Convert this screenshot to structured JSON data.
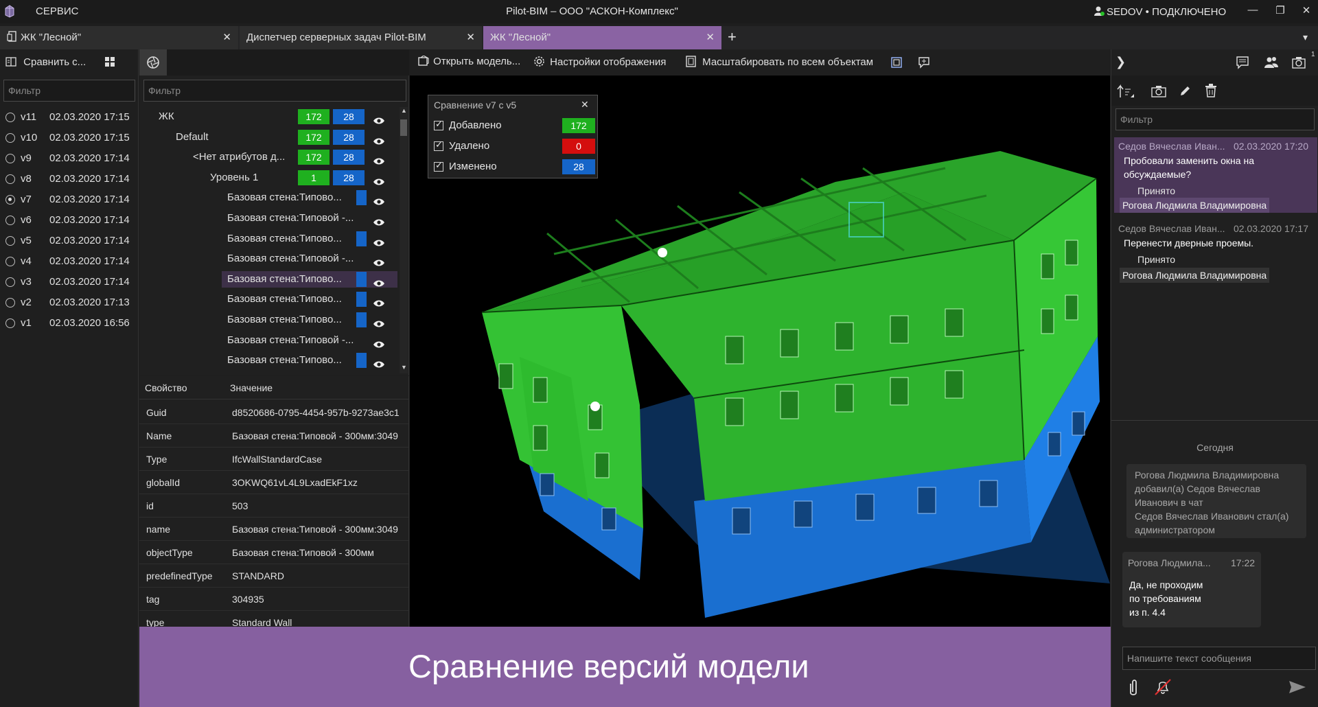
{
  "titlebar": {
    "menu": "СЕРВИС",
    "title": "Pilot-BIM – ООО \"АСКОН-Комплекс\"",
    "user": "SEDOV • ПОДКЛЮЧЕНО",
    "minimize": "—",
    "restore": "❐",
    "close": "✕",
    "dropdown": "▾"
  },
  "tabs": [
    {
      "label": "ЖК \"Лесной\"",
      "close": "✕"
    },
    {
      "label": "Диспетчер серверных задач Pilot-BIM",
      "close": "✕"
    },
    {
      "label": "ЖК \"Лесной\"",
      "close": "✕"
    }
  ],
  "tab_add": "+",
  "left": {
    "compare_label": "Сравнить с...",
    "filter_placeholder": "Фильтр",
    "versions": [
      {
        "name": "v11",
        "date": "02.03.2020 17:15",
        "selected": false
      },
      {
        "name": "v10",
        "date": "02.03.2020 17:15",
        "selected": false
      },
      {
        "name": "v9",
        "date": "02.03.2020 17:14",
        "selected": false
      },
      {
        "name": "v8",
        "date": "02.03.2020 17:14",
        "selected": false
      },
      {
        "name": "v7",
        "date": "02.03.2020 17:14",
        "selected": true
      },
      {
        "name": "v6",
        "date": "02.03.2020 17:14",
        "selected": false
      },
      {
        "name": "v5",
        "date": "02.03.2020 17:14",
        "selected": false
      },
      {
        "name": "v4",
        "date": "02.03.2020 17:14",
        "selected": false
      },
      {
        "name": "v3",
        "date": "02.03.2020 17:14",
        "selected": false
      },
      {
        "name": "v2",
        "date": "02.03.2020 17:13",
        "selected": false
      },
      {
        "name": "v1",
        "date": "02.03.2020 16:56",
        "selected": false
      }
    ]
  },
  "tree": {
    "filter_placeholder": "Фильтр",
    "rows": [
      {
        "label": "ЖК",
        "indent": 0,
        "added": "172",
        "changed": "28"
      },
      {
        "label": "Default",
        "indent": 1,
        "added": "172",
        "changed": "28"
      },
      {
        "label": "<Нет атрибутов д...",
        "indent": 2,
        "added": "172",
        "changed": "28"
      },
      {
        "label": "Уровень 1",
        "indent": 3,
        "added": "1",
        "changed": "28"
      },
      {
        "label": "Базовая стена:Типово...",
        "indent": 4,
        "added": "",
        "changed": "■"
      },
      {
        "label": "Базовая стена:Типовой -...",
        "indent": 4,
        "added": "",
        "changed": ""
      },
      {
        "label": "Базовая стена:Типово...",
        "indent": 4,
        "added": "",
        "changed": "■"
      },
      {
        "label": "Базовая стена:Типовой -...",
        "indent": 4,
        "added": "",
        "changed": ""
      },
      {
        "label": "Базовая стена:Типово...",
        "indent": 4,
        "added": "",
        "changed": "■",
        "highlight": true
      },
      {
        "label": "Базовая стена:Типово...",
        "indent": 4,
        "added": "",
        "changed": "■"
      },
      {
        "label": "Базовая стена:Типово...",
        "indent": 4,
        "added": "",
        "changed": "■"
      },
      {
        "label": "Базовая стена:Типовой -...",
        "indent": 4,
        "added": "",
        "changed": ""
      },
      {
        "label": "Базовая стена:Типово...",
        "indent": 4,
        "added": "",
        "changed": "■"
      }
    ]
  },
  "props": {
    "header_key": "Свойство",
    "header_value": "Значение",
    "rows": [
      {
        "k": "Guid",
        "v": "d8520686-0795-4454-957b-9273ae3c1"
      },
      {
        "k": "Name",
        "v": "Базовая стена:Типовой - 300мм:3049"
      },
      {
        "k": "Type",
        "v": "IfcWallStandardCase"
      },
      {
        "k": "globalId",
        "v": "3OKWQ61vL4L9LxadEkF1xz"
      },
      {
        "k": "id",
        "v": "503"
      },
      {
        "k": "name",
        "v": "Базовая стена:Типовой - 300мм:3049"
      },
      {
        "k": "objectType",
        "v": "Базовая стена:Типовой - 300мм"
      },
      {
        "k": "predefinedType",
        "v": "STANDARD"
      },
      {
        "k": "tag",
        "v": "304935"
      },
      {
        "k": "type",
        "v": "Standard Wall"
      }
    ]
  },
  "viewer_toolbar": {
    "open_model": "Открыть модель...",
    "display_settings": "Настройки отображения",
    "fit_all": "Масштабировать по всем объектам"
  },
  "compare_popup": {
    "title": "Сравнение v7 с v5",
    "close": "✕",
    "rows": [
      {
        "label": "Добавлено",
        "value": "172",
        "color": "#1fb01f"
      },
      {
        "label": "Удалено",
        "value": "0",
        "color": "#d40e0e"
      },
      {
        "label": "Изменено",
        "value": "28",
        "color": "#1565c8"
      }
    ]
  },
  "banner": {
    "text": "Сравнение версий модели"
  },
  "right": {
    "filter_placeholder": "Фильтр",
    "comments": [
      {
        "author": "Седов Вячеслав Иван...",
        "time": "02.03.2020 17:20",
        "text": "Пробовали заменить окна на обсуждаемые?",
        "status": "Принято",
        "assignee": "Рогова Людмила Владимировна",
        "active": true
      },
      {
        "author": "Седов Вячеслав Иван...",
        "time": "02.03.2020 17:17",
        "text": "Перенести дверные проемы.",
        "status": "Принято",
        "assignee": "Рогова Людмила Владимировна",
        "active": false
      }
    ],
    "today": "Сегодня",
    "system_msg": "Рогова Людмила Владимировна добавил(а) Седов Вячеслав Иванович в чат\nСедов Вячеслав Иванович стал(а) администратором",
    "chat_author": "Рогова Людмила...",
    "chat_time": "17:22",
    "chat_text": "Да, не проходим по требованиям из п. 4.4",
    "input_placeholder": "Напишите текст сообщения",
    "badge_count": "1"
  }
}
